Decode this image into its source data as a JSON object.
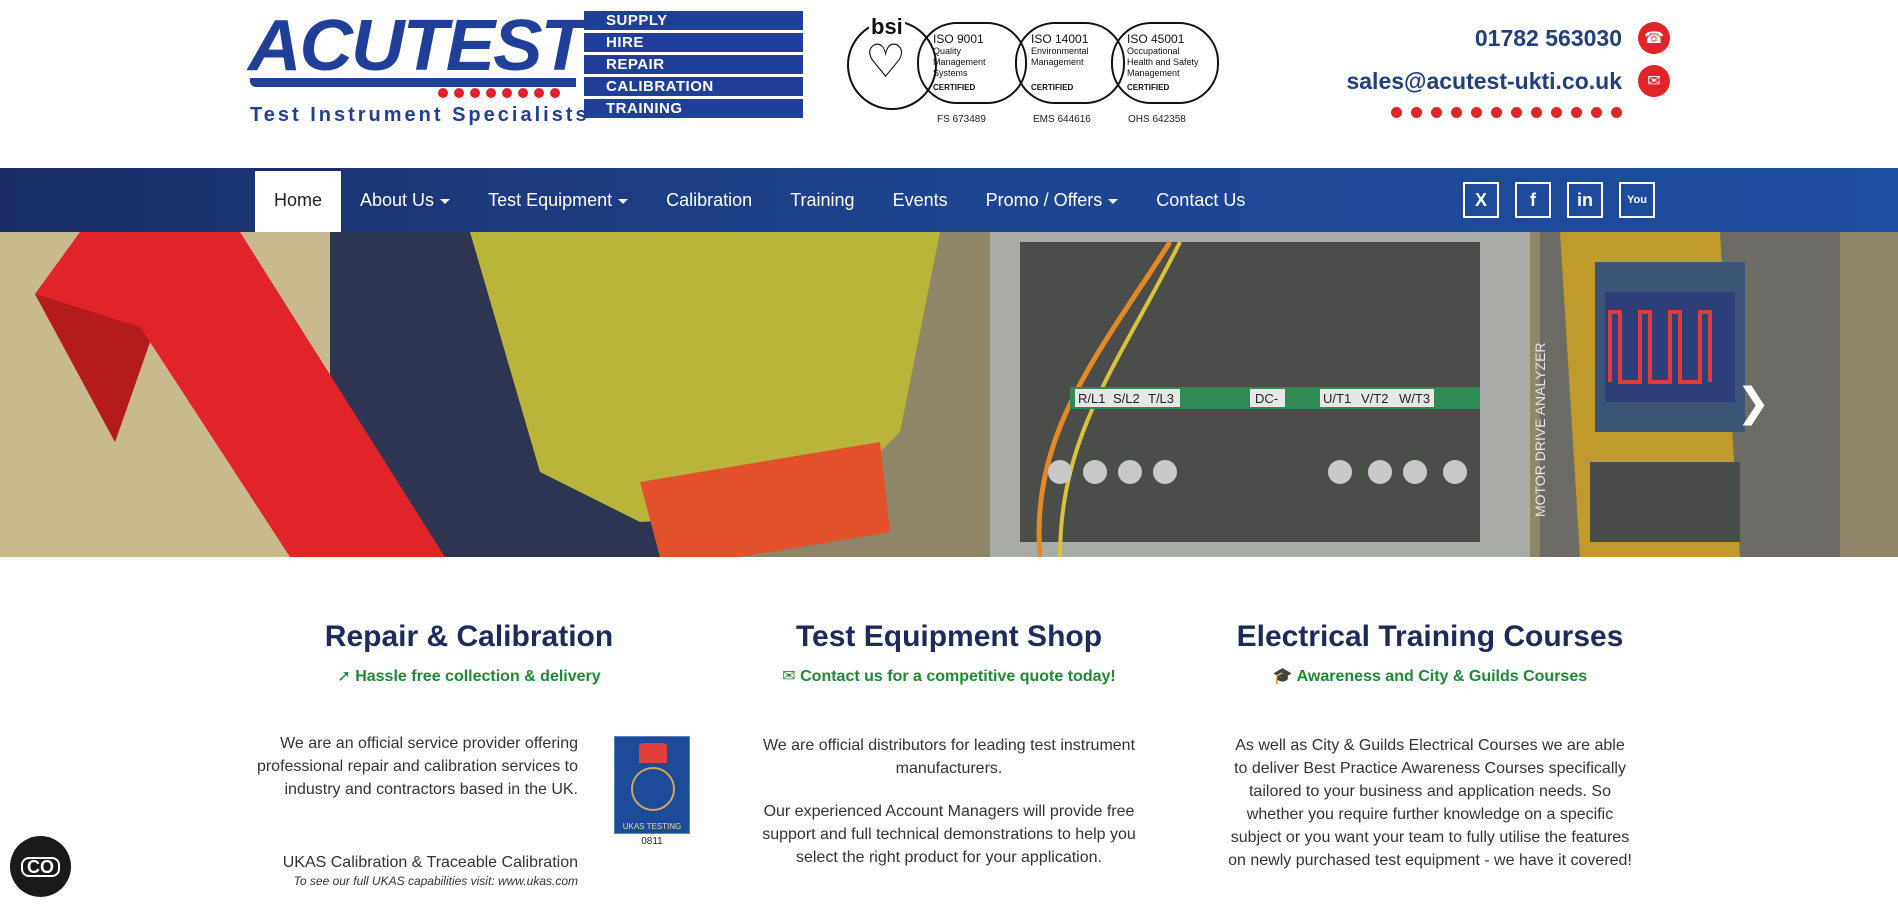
{
  "logo": {
    "word": "ACUTEST",
    "tagline": "Test Instrument Specialists"
  },
  "services": [
    "SUPPLY",
    "HIRE",
    "REPAIR",
    "CALIBRATION",
    "TRAINING"
  ],
  "bsi": {
    "brand": "bsi",
    "certs": [
      {
        "std": "ISO 9001",
        "desc": "Quality Management Systems",
        "cert": "CERTIFIED",
        "num": "FS 673489"
      },
      {
        "std": "ISO 14001",
        "desc": "Environmental Management",
        "cert": "CERTIFIED",
        "num": "EMS 644616"
      },
      {
        "std": "ISO 45001",
        "desc": "Occupational Health and Safety Management",
        "cert": "CERTIFIED",
        "num": "OHS 642358"
      }
    ]
  },
  "contact": {
    "phone": "01782 563030",
    "email": "sales@acutest-ukti.co.uk"
  },
  "nav": {
    "items": [
      {
        "label": "Home",
        "dropdown": false
      },
      {
        "label": "About Us",
        "dropdown": true
      },
      {
        "label": "Test Equipment",
        "dropdown": true
      },
      {
        "label": "Calibration",
        "dropdown": false
      },
      {
        "label": "Training",
        "dropdown": false
      },
      {
        "label": "Events",
        "dropdown": false
      },
      {
        "label": "Promo / Offers",
        "dropdown": true
      },
      {
        "label": "Contact Us",
        "dropdown": false
      }
    ]
  },
  "social": [
    "x-icon",
    "facebook-icon",
    "linkedin-icon",
    "youtube-icon"
  ],
  "hero": {
    "terminal_labels": [
      "R/L1",
      "S/L2",
      "T/L3",
      "DC-",
      "U/T1",
      "V/T2",
      "W/T3"
    ],
    "device_label": "MOTOR DRIVE ANALYZER"
  },
  "columns": {
    "repair": {
      "title": "Repair & Calibration",
      "subtitle": "Hassle free collection & delivery",
      "body": "We are an official service provider offering professional repair and calibration services to industry and contractors based in the UK.",
      "ukas_label": "UKAS TESTING",
      "ukas_number": "0811",
      "foot_line1": "UKAS Calibration & Traceable Calibration",
      "foot_line2": "To see our full UKAS capabilities visit: www.ukas.com"
    },
    "shop": {
      "title": "Test Equipment Shop",
      "subtitle": "Contact us for a competitive quote today!",
      "body1": "We are official distributors for leading test instrument manufacturers.",
      "body2": "Our experienced Account Managers will provide free support and full technical demonstrations to help you select the right product for your application."
    },
    "training": {
      "title": "Electrical Training Courses",
      "subtitle": "Awareness and City & Guilds Courses",
      "body": "As well as City & Guilds Electrical Courses we are able to deliver Best Practice Awareness Courses specifically tailored to your business and application needs. So whether you require further knowledge on a specific subject or you want your team to fully utilise the features on newly purchased test equipment - we have it covered!"
    }
  },
  "cookie": {
    "label": "CO"
  }
}
